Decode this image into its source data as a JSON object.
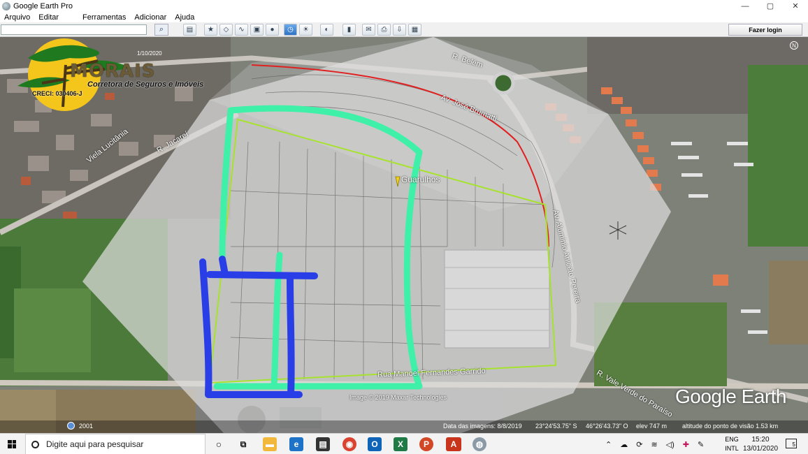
{
  "window": {
    "title": "Google Earth Pro",
    "controls": {
      "minimize": "—",
      "maximize": "▢",
      "close": "✕"
    }
  },
  "menu": {
    "items": [
      "Arquivo",
      "Editar",
      "Ferramentas",
      "Adicionar",
      "Ajuda"
    ]
  },
  "toolbar": {
    "search_value": "",
    "login_label": "Fazer login"
  },
  "logo": {
    "brand": "MORAIS",
    "tagline": "Corretora de Seguros e Imóveis",
    "creci": "CRECI: 030406-J",
    "date": "1/10/2020"
  },
  "map": {
    "streets": [
      "R. Belém",
      "Av. José Brumatti",
      "R. Jacareí",
      "Viela Lucitânia",
      "Rua Manoel Fernandes Garrido",
      "R. Vale Verde do Paraíso",
      "Av. Aluminio Aniceto Pereira"
    ],
    "city": "Guarulhos",
    "watermark": "Google Earth",
    "copyright": "Image © 2019 Maxar Technologies",
    "historical_year": "2001",
    "overlay_colors": {
      "green": "#3ff0a8",
      "blue": "#2a3ee8",
      "red": "#e02020",
      "boundary": "#a6e22e"
    }
  },
  "statusbar": {
    "image_date": "Data das imagens: 8/8/2019",
    "lat": "23°24'53.75\" S",
    "lon": "46°26'43.73\" O",
    "elev": "elev   747 m",
    "eye_alt": "altitude do ponto de visão   1.53 km"
  },
  "taskbar": {
    "search_placeholder": "Digite aqui para pesquisar",
    "lang_top": "ENG",
    "lang_bottom": "INTL",
    "time": "15:20",
    "date": "13/01/2020",
    "notifications": "5"
  }
}
